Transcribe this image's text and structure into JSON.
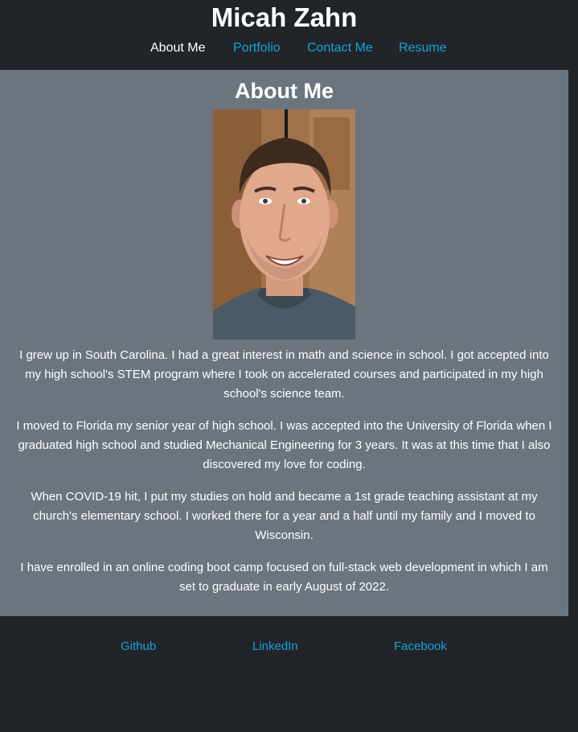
{
  "header": {
    "title": "Micah Zahn",
    "nav": [
      {
        "label": "About Me",
        "active": true
      },
      {
        "label": "Portfolio",
        "active": false
      },
      {
        "label": "Contact Me",
        "active": false
      },
      {
        "label": "Resume",
        "active": false
      }
    ]
  },
  "about": {
    "heading": "About Me",
    "photo_icon": "portrait-photo",
    "paragraphs": [
      "I grew up in South Carolina. I had a great interest in math and science in school. I got accepted into my high school's STEM program where I took on accelerated courses and participated in my high school's science team.",
      "I moved to Florida my senior year of high school. I was accepted into the University of Florida when I graduated high school and studied Mechanical Engineering for 3 years. It was at this time that I also discovered my love for coding.",
      "When COVID-19 hit, I put my studies on hold and became a 1st grade teaching assistant at my church's elementary school. I worked there for a year and a half until my family and I moved to Wisconsin.",
      "I have enrolled in an online coding boot camp focused on full-stack web development in which I am set to graduate in early August of 2022."
    ]
  },
  "footer": {
    "links": [
      {
        "label": "Github"
      },
      {
        "label": "LinkedIn"
      },
      {
        "label": "Facebook"
      }
    ]
  },
  "colors": {
    "background": "#212529",
    "content_background": "#6c757d",
    "link": "#17a2d8",
    "text": "#ffffff"
  }
}
